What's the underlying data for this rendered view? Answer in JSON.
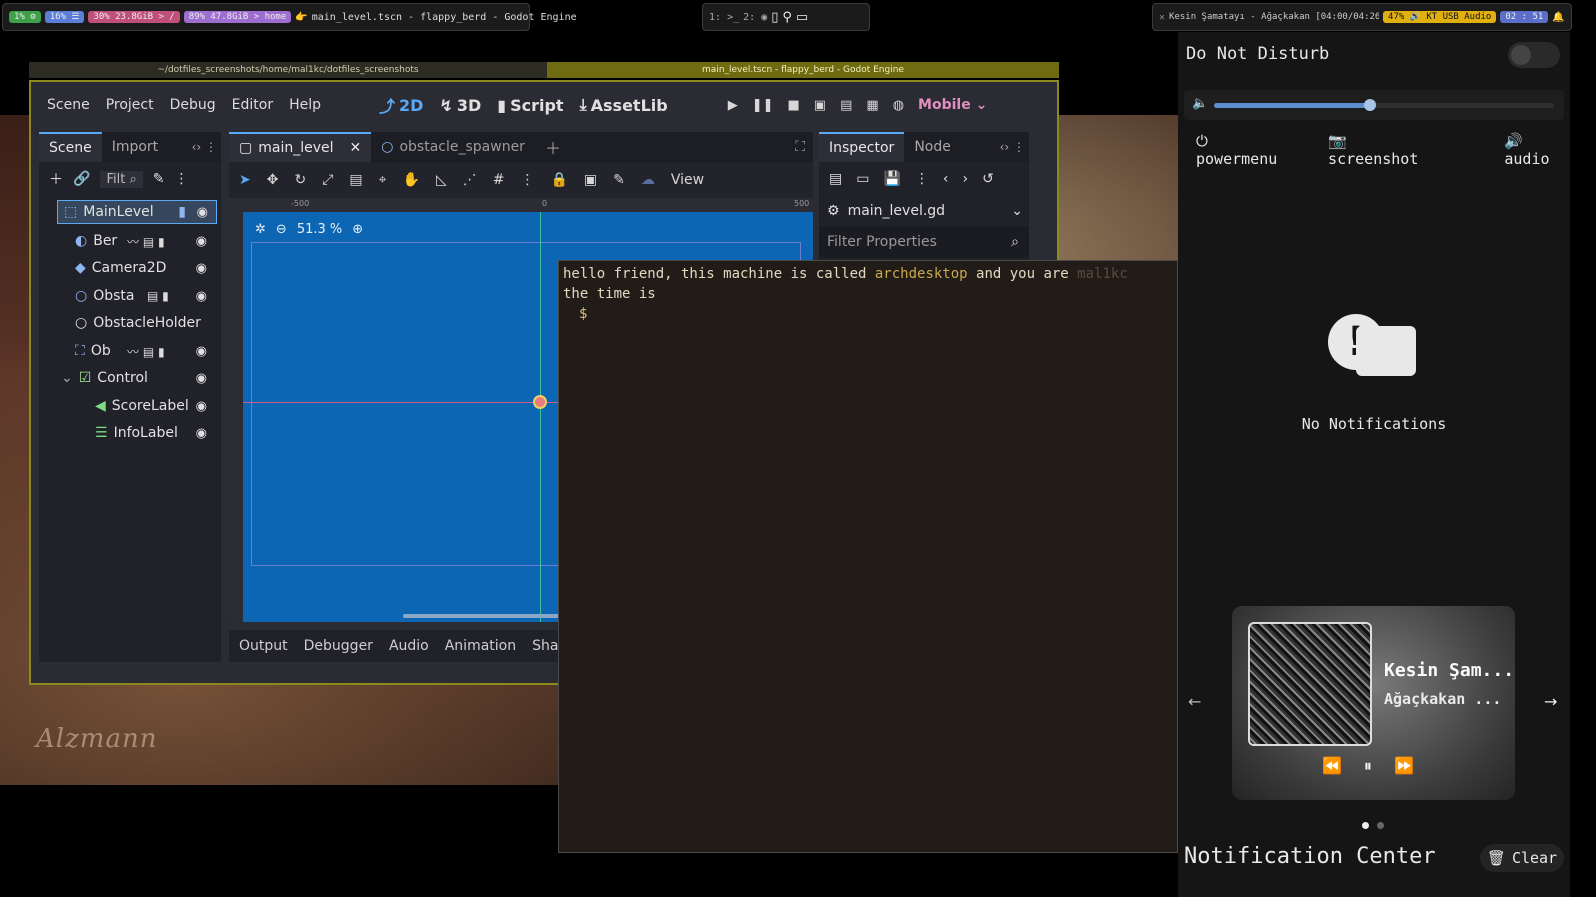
{
  "topbar": {
    "left": {
      "pills": [
        {
          "text": "1% ⚙",
          "color": "#3fa04a"
        },
        {
          "text": "16% ☰",
          "color": "#5b7fd9"
        },
        {
          "text": "30% 23.8GiB > /",
          "color": "#c0507a"
        },
        {
          "text": "89% 47.8GiB > home",
          "color": "#9d6ed0"
        }
      ],
      "window_title": "main_level.tscn - flappy_berd - Godot Engine"
    },
    "workspaces": [
      {
        "id": "1:",
        "icon": ">_"
      },
      {
        "id": "2:",
        "icon": "◉"
      }
    ],
    "right": {
      "media": "Kesin Şamatayı - Ağaçkakan [04:00/04:26]",
      "volume": "47% 🔊 KT USB Audio",
      "clock": "02 : 51"
    }
  },
  "godot": {
    "title_left": "~/dotfiles_screenshots/home/mal1kc/dotfiles_screenshots",
    "title_right": "main_level.tscn - flappy_berd - Godot Engine",
    "menu": [
      "Scene",
      "Project",
      "Debug",
      "Editor",
      "Help"
    ],
    "workspaces": [
      "2D",
      "3D",
      "Script",
      "AssetLib"
    ],
    "renderer": "Mobile",
    "scene_tabs": [
      "Scene",
      "Import"
    ],
    "filter_placeholder": "Filt",
    "tree": [
      {
        "label": "MainLevel",
        "depth": 0,
        "icon": "node2d-icon"
      },
      {
        "label": "Ber",
        "depth": 1,
        "icon": "rigidbody-icon"
      },
      {
        "label": "Camera2D",
        "depth": 1,
        "icon": "camera-icon"
      },
      {
        "label": "Obsta",
        "depth": 1,
        "icon": "node-icon"
      },
      {
        "label": "ObstacleHolder",
        "depth": 1,
        "icon": "node-icon"
      },
      {
        "label": "Ob",
        "depth": 1,
        "icon": "area-icon"
      },
      {
        "label": "Control",
        "depth": 1,
        "icon": "control-icon"
      },
      {
        "label": "ScoreLabel",
        "depth": 2,
        "icon": "label-icon"
      },
      {
        "label": "InfoLabel",
        "depth": 2,
        "icon": "richtext-icon"
      }
    ],
    "editor_tabs": [
      "main_level",
      "obstacle_spawner"
    ],
    "view_label": "View",
    "zoom": "51.3 %",
    "ruler": [
      "-500",
      "0",
      "500"
    ],
    "bottom_tabs": [
      "Output",
      "Debugger",
      "Audio",
      "Animation",
      "Shade"
    ],
    "inspector_tabs": [
      "Inspector",
      "Node"
    ],
    "inspector_resource": "main_level.gd",
    "filter_properties": "Filter Properties"
  },
  "terminal": {
    "line1_a": "hello friend, this machine is called ",
    "line1_host": "archdesktop",
    "line1_b": "  and you are ",
    "line1_user": "mal1kc",
    "line2": "the time is",
    "prompt": "$"
  },
  "notification_center": {
    "dnd_label": "Do Not Disturb",
    "volume_level": 0.46,
    "quick_actions": [
      "powermenu",
      "screenshot",
      "audio"
    ],
    "empty_text": "No Notifications",
    "player": {
      "title": "Kesin Şam...",
      "artist": "Ağaçkakan ..."
    },
    "footer_title": "Notification Center",
    "clear_label": "Clear"
  },
  "colors": {
    "accent": "#5aa9f5",
    "godot_border": "#8d8a1c",
    "viewport": "#0c66b4",
    "terminal_host": "#c9a74a"
  }
}
